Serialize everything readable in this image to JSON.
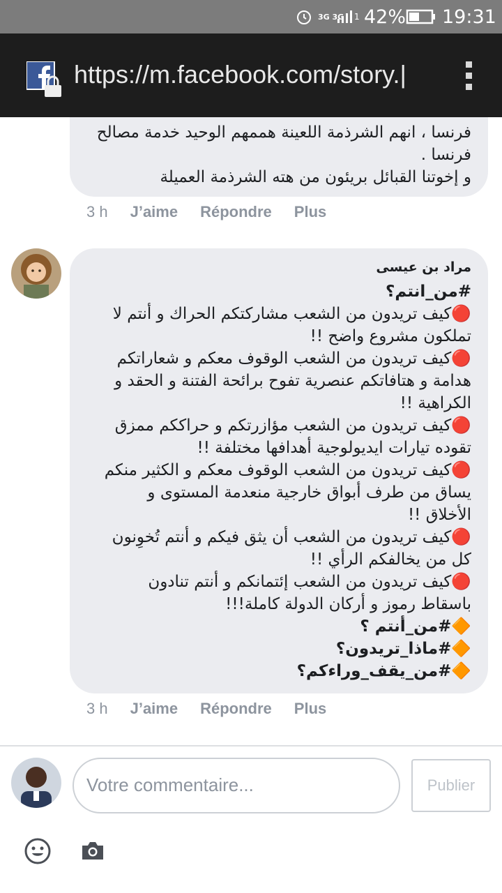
{
  "status_bar": {
    "network": "3G 3G",
    "sim": "1",
    "battery_percent": "42%",
    "time": "19:31",
    "icons": [
      "alarm-icon",
      "signal-icon",
      "battery-icon"
    ]
  },
  "browser": {
    "url": "https://m.facebook.com/story.|",
    "icons": [
      "facebook-lock-icon",
      "kebab-menu-icon"
    ]
  },
  "comments": [
    {
      "author": "",
      "lines": [
        "فرنسا ، انهم الشرذمة اللعينة هممهم الوحيد خدمة مصالح",
        "فرنسا .",
        "و إخوتنا القبائل بريئون من هته الشرذمة العميلة"
      ],
      "actions": {
        "timestamp": "3 h",
        "like": "J’aime",
        "reply": "Répondre",
        "more": "Plus"
      }
    },
    {
      "author": "مراد بن عيسى",
      "lines": [
        "#من_انتم؟",
        "🔴كيف تريدون من الشعب مشاركتكم الحراك و أنتم لا",
        "تملكون مشروع واضح !!",
        "🔴كيف تريدون من الشعب الوقوف معكم و شعاراتكم",
        "هدامة و هتافاتكم عنصرية تفوح برائحة الفتنة و الحقد و",
        "الكراهية !!",
        "🔴كيف تريدون من الشعب مؤازرتكم و حراككم ممزق",
        "تقوده تيارات ايديولوجية أهدافها مختلفة !!",
        "🔴كيف تريدون من الشعب الوقوف معكم و الكثير منكم",
        "يساق من طرف أبواق خارجية منعدمة المستوى و",
        "الأخلاق !!",
        "🔴كيف تريدون من الشعب أن يثق فيكم و أنتم تُخوِنون",
        "كل من يخالفكم الرأي !!",
        "🔴كيف تريدون من الشعب إئتمانكم و أنتم تنادون",
        "باسقاط رموز و أركان الدولة كاملة!!!",
        "🔶#من_أنتم ؟",
        "🔶#ماذا_تريدون؟",
        "🔶#من_يقف_وراءكم؟"
      ],
      "actions": {
        "timestamp": "3 h",
        "like": "J’aime",
        "reply": "Répondre",
        "more": "Plus"
      }
    }
  ],
  "composer": {
    "placeholder": "Votre commentaire...",
    "publish_label": "Publier",
    "icons": [
      "emoji-icon",
      "camera-icon"
    ]
  },
  "colors": {
    "bubble": "#ebecf0",
    "action_text": "#8d949e",
    "url_bar": "#1d1d1d",
    "status_bar": "#7c7c7c"
  }
}
